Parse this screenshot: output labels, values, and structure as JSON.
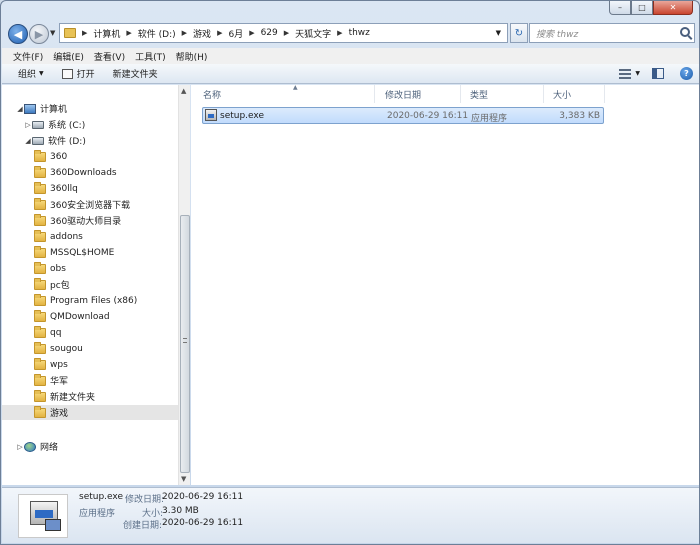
{
  "window": {
    "caption_buttons": [
      "–",
      "□",
      "✕"
    ]
  },
  "address_bar": {
    "breadcrumbs": [
      "计算机",
      "软件 (D:)",
      "游戏",
      "6月",
      "629",
      "天狐文字",
      "thwz"
    ],
    "search_placeholder": "搜索 thwz"
  },
  "menu": [
    "文件(F)",
    "编辑(E)",
    "查看(V)",
    "工具(T)",
    "帮助(H)"
  ],
  "toolbar": {
    "organize": "组织",
    "open": "打开",
    "new_folder": "新建文件夹"
  },
  "nav_tree": {
    "computer": "计算机",
    "drive_c": "系统 (C:)",
    "drive_d": "软件 (D:)",
    "folders": [
      "360",
      "360Downloads",
      "360llq",
      "360安全浏览器下载",
      "360驱动大师目录",
      "addons",
      "MSSQL$HOME",
      "obs",
      "pc包",
      "Program Files (x86)",
      "QMDownload",
      "qq",
      "sougou",
      "wps",
      "华军",
      "新建文件夹",
      "游戏"
    ],
    "selected": "游戏",
    "network": "网络"
  },
  "columns": [
    "名称",
    "修改日期",
    "类型",
    "大小"
  ],
  "files": [
    {
      "name": "setup.exe",
      "modified": "2020-06-29 16:11",
      "type": "应用程序",
      "size": "3,383 KB"
    }
  ],
  "details": {
    "name": "setup.exe",
    "type": "应用程序",
    "modified_label": "修改日期:",
    "modified": "2020-06-29 16:11",
    "size_label": "大小:",
    "size": "3.30 MB",
    "created_label": "创建日期:",
    "created": "2020-06-29 16:11"
  },
  "icons": [
    "back-icon",
    "forward-icon",
    "folder-icon",
    "refresh-icon",
    "search-icon",
    "open-icon",
    "view-icon",
    "preview-pane-icon",
    "help-icon",
    "computer-icon",
    "drive-icon",
    "network-icon",
    "exe-icon"
  ]
}
